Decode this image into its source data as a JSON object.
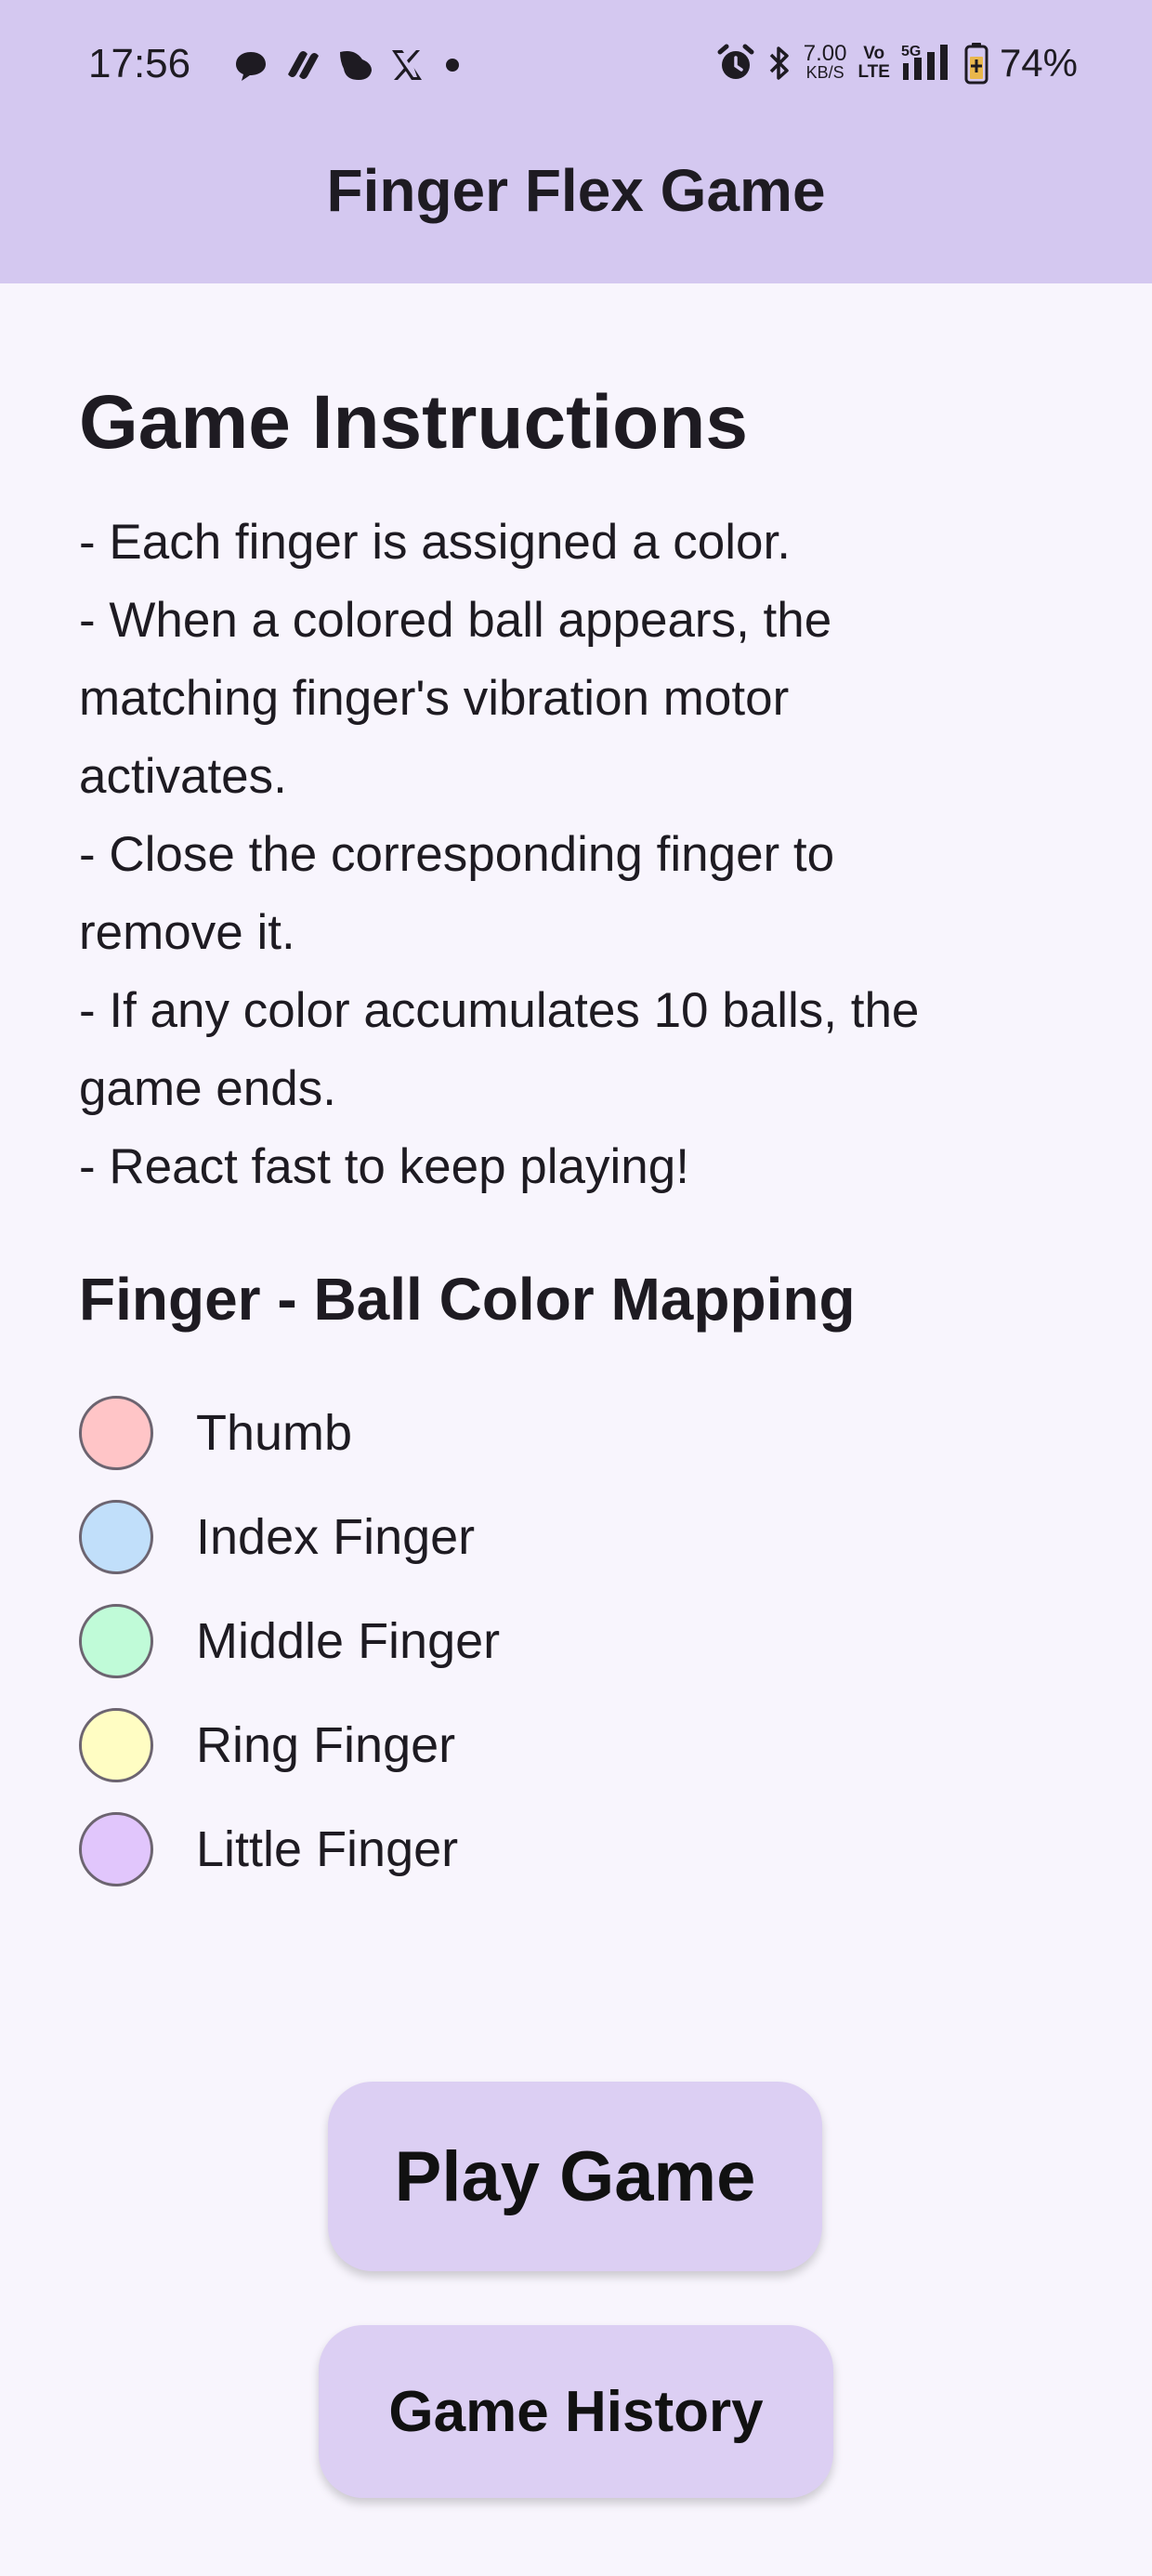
{
  "status_bar": {
    "time": "17:56",
    "notification_icons": [
      "chat-bubble-icon",
      "link-icon",
      "bird-icon",
      "x-icon",
      "dot-icon"
    ],
    "net_speed_value": "7.00",
    "net_speed_unit": "KB/S",
    "volte_top": "Vo",
    "volte_bottom": "LTE",
    "network_type": "5G",
    "battery": "74%"
  },
  "app_bar": {
    "title": "Finger Flex Game"
  },
  "instructions": {
    "title": "Game Instructions",
    "lines": [
      "- Each finger is assigned a color.",
      "- When a colored ball appears, the",
      "matching finger's vibration motor",
      "activates.",
      "- Close the corresponding finger to",
      "remove it.",
      "- If any color accumulates 10 balls, the",
      "game ends.",
      "- React fast to keep playing!"
    ]
  },
  "mapping": {
    "title": "Finger - Ball Color Mapping",
    "items": [
      {
        "label": "Thumb",
        "color": "#FFC5C7"
      },
      {
        "label": "Index Finger",
        "color": "#C1DFFA"
      },
      {
        "label": "Middle Finger",
        "color": "#C0FBD8"
      },
      {
        "label": "Ring Finger",
        "color": "#FFFDC3"
      },
      {
        "label": "Little Finger",
        "color": "#E1C6FC"
      }
    ]
  },
  "buttons": {
    "play": "Play Game",
    "history": "Game History"
  },
  "colors": {
    "app_bar": "#D4C8F0",
    "background": "#F8F5FD",
    "button": "#DCCFF3"
  }
}
